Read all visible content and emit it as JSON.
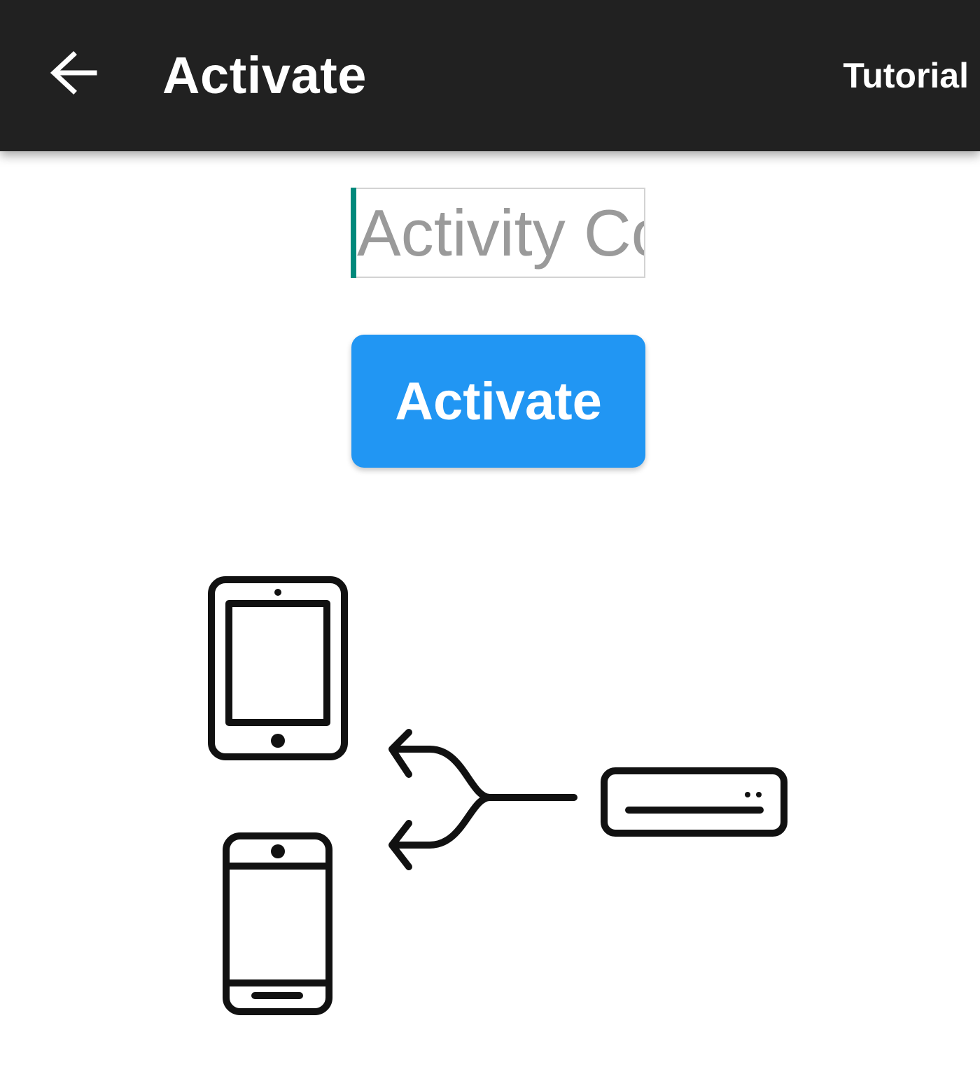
{
  "header": {
    "back_icon": "arrow-left-icon",
    "title": "Activate",
    "tutorial_label": "Tutorial",
    "background": "#212121"
  },
  "form": {
    "code_input": {
      "value": "",
      "placeholder": "Activity Code"
    },
    "activate_label": "Activate",
    "accent_color": "#2196f3",
    "caret_color": "#00897b"
  },
  "illustration": {
    "icons": [
      "tablet-icon",
      "smartphone-icon",
      "branching-arrow-icon",
      "set-top-box-icon"
    ]
  }
}
